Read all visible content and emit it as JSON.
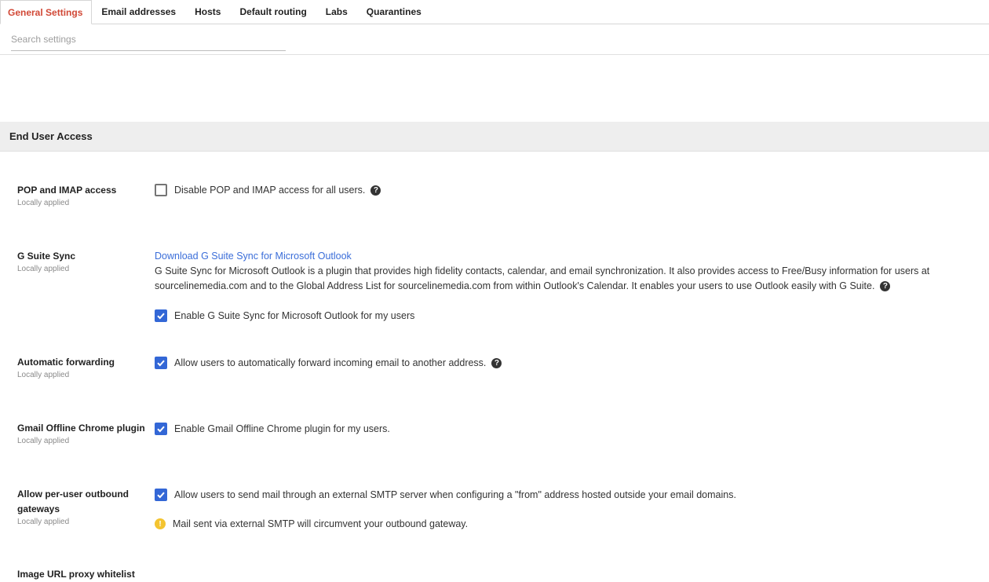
{
  "tabs": [
    {
      "label": "General Settings",
      "active": true
    },
    {
      "label": "Email addresses",
      "active": false
    },
    {
      "label": "Hosts",
      "active": false
    },
    {
      "label": "Default routing",
      "active": false
    },
    {
      "label": "Labs",
      "active": false
    },
    {
      "label": "Quarantines",
      "active": false
    }
  ],
  "search": {
    "placeholder": "Search settings",
    "value": ""
  },
  "section": {
    "title": "End User Access"
  },
  "settings": {
    "pop_imap": {
      "label": "POP and IMAP access",
      "status": "Locally applied",
      "checkbox_label": "Disable POP and IMAP access for all users.",
      "checked": false
    },
    "gsuite_sync": {
      "label": "G Suite Sync",
      "status": "Locally applied",
      "link": "Download G Suite Sync for Microsoft Outlook",
      "description": "G Suite Sync for Microsoft Outlook is a plugin that provides high fidelity contacts, calendar, and email synchronization. It also provides access to Free/Busy information for users at sourcelinemedia.com and to the Global Address List for sourcelinemedia.com from within Outlook's Calendar. It enables your users to use Outlook easily with G Suite.",
      "checkbox_label": "Enable G Suite Sync for Microsoft Outlook for my users",
      "checked": true
    },
    "auto_forward": {
      "label": "Automatic forwarding",
      "status": "Locally applied",
      "checkbox_label": "Allow users to automatically forward incoming email to another address.",
      "checked": true
    },
    "gmail_offline": {
      "label": "Gmail Offline Chrome plugin",
      "status": "Locally applied",
      "checkbox_label": "Enable Gmail Offline Chrome plugin for my users.",
      "checked": true
    },
    "outbound_gateways": {
      "label": "Allow per-user outbound gateways",
      "status": "Locally applied",
      "checkbox_label": "Allow users to send mail through an external SMTP server when configuring a \"from\" address hosted outside your email domains.",
      "checked": true,
      "warning": "Mail sent via external SMTP will circumvent your outbound gateway."
    },
    "image_proxy": {
      "label": "Image URL proxy whitelist"
    }
  },
  "icons": {
    "help": "help-circle-icon",
    "warning": "warning-circle-icon",
    "check": "checkmark-icon"
  },
  "colors": {
    "active_tab": "#d14836",
    "checkbox_checked": "#3367d6",
    "link": "#3b6ed9",
    "warning": "#f4c430",
    "section_bg": "#eeeeee"
  }
}
